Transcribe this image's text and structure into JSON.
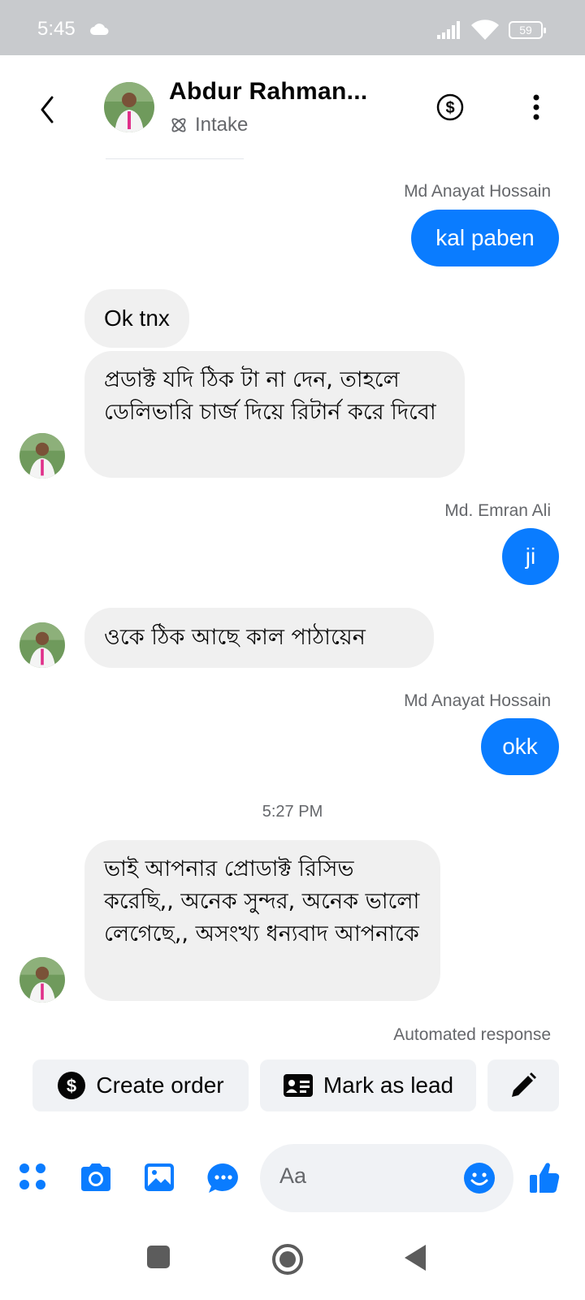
{
  "status_bar": {
    "time": "5:45",
    "battery": "59"
  },
  "header": {
    "contact_name": "Abdur Rahman...",
    "label": "Intake"
  },
  "messages": {
    "m1_sender": "Md Anayat Hossain",
    "m1_text": "kal paben",
    "m2_text": "Ok tnx",
    "m3_text": "প্রডাক্ট যদি ঠিক টা না দেন,  তাহলে ডেলিভারি চার্জ দিয়ে রিটার্ন করে দিবো",
    "m4_sender": "Md. Emran Ali",
    "m4_text": "ji",
    "m5_text": "ওকে ঠিক আছে  কাল পাঠায়েন",
    "m6_sender": "Md Anayat Hossain",
    "m6_text": "okk",
    "timestamp": "5:27 PM",
    "m7_text": "ভাই আপনার প্রোডাক্ট রিসিভ করেছি,, অনেক সুন্দর, অনেক ভালো লেগেছে,, অসংখ্য ধন্যবাদ আপনাকে",
    "automated_label": "Automated response"
  },
  "quick_actions": {
    "create_order": "Create order",
    "mark_as_lead": "Mark as lead"
  },
  "composer": {
    "placeholder": "Aa"
  },
  "colors": {
    "accent": "#0a7cff",
    "incoming_bubble": "#f0f0f0",
    "status_bar": "#c8cacd"
  }
}
